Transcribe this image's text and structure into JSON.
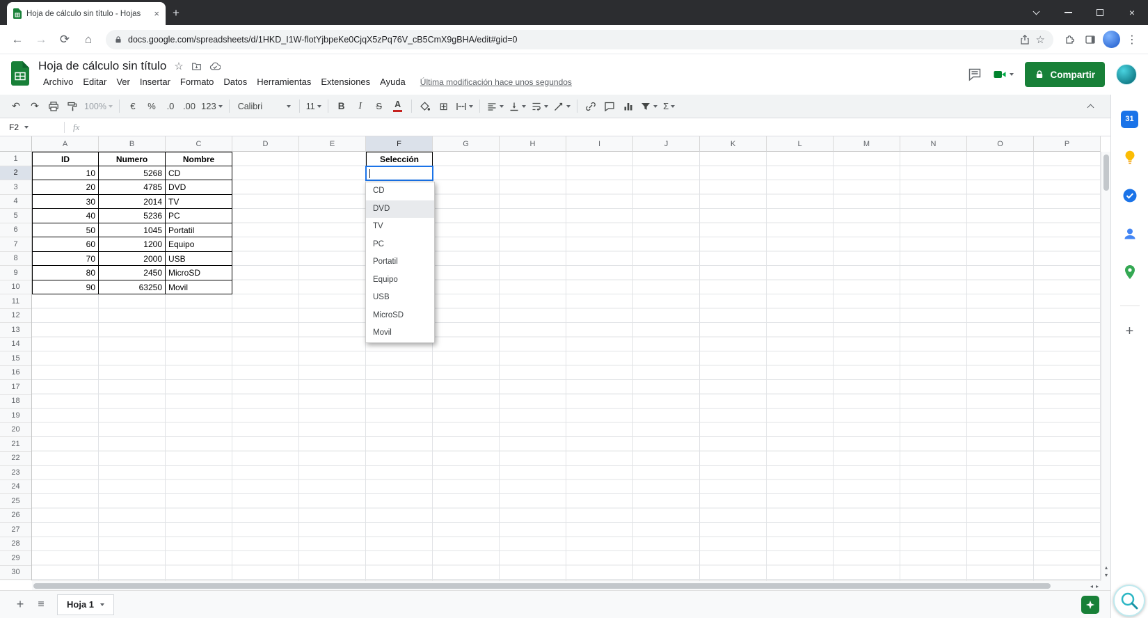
{
  "browser": {
    "tab_title": "Hoja de cálculo sin título - Hojas",
    "url": "docs.google.com/spreadsheets/d/1HKD_I1W-flotYjbpeKe0CjqX5zPq76V_cB5CmX9gBHA/edit#gid=0"
  },
  "icons": {
    "back": "←",
    "forward": "→",
    "reload": "⟳",
    "home": "⌂",
    "star": "☆",
    "kebab": "⋮",
    "new_tab": "+",
    "tab_close": "×",
    "close": "×",
    "undo": "↶",
    "redo": "↷",
    "borders": "⊞",
    "sigma": "Σ",
    "hamburger": "≡",
    "add_sheet": "+",
    "plus": "+",
    "scroll_left": "◂",
    "scroll_right": "▸",
    "scroll_up": "▴",
    "scroll_down": "▾"
  },
  "app": {
    "title": "Hoja de cálculo sin título",
    "menu_items": [
      "Archivo",
      "Editar",
      "Ver",
      "Insertar",
      "Formato",
      "Datos",
      "Herramientas",
      "Extensiones",
      "Ayuda"
    ],
    "last_modified": "Última modificación hace unos segundos",
    "share_button": "Compartir"
  },
  "toolbar": {
    "zoom": "100%",
    "currency": "€",
    "percent": "%",
    "dec_dec": ".0",
    "inc_dec": ".00",
    "num_fmt": "123",
    "font": "Calibri",
    "font_size": "11",
    "bold": "B",
    "italic": "I",
    "strike": "S",
    "text_color": "A"
  },
  "formula_bar": {
    "cell_ref": "F2",
    "fx": "fx"
  },
  "sheet": {
    "columns": [
      "A",
      "B",
      "C",
      "D",
      "E",
      "F",
      "G",
      "H",
      "I",
      "J",
      "K",
      "L",
      "M",
      "N",
      "O",
      "P"
    ],
    "rows": 30,
    "active_column": "F",
    "active_row": 2,
    "cells": [
      {
        "c": "A",
        "r": 1,
        "t": "ID",
        "bold": true,
        "align": "center",
        "box": true
      },
      {
        "c": "B",
        "r": 1,
        "t": "Numero",
        "bold": true,
        "align": "center",
        "box": true
      },
      {
        "c": "C",
        "r": 1,
        "t": "Nombre",
        "bold": true,
        "align": "center",
        "box": true
      },
      {
        "c": "F",
        "r": 1,
        "t": "Selección",
        "bold": true,
        "align": "center",
        "box": true
      },
      {
        "c": "A",
        "r": 2,
        "t": "10",
        "align": "right",
        "box": true
      },
      {
        "c": "B",
        "r": 2,
        "t": "5268",
        "align": "right",
        "box": true
      },
      {
        "c": "C",
        "r": 2,
        "t": "CD",
        "align": "left",
        "box": true
      },
      {
        "c": "A",
        "r": 3,
        "t": "20",
        "align": "right",
        "box": true
      },
      {
        "c": "B",
        "r": 3,
        "t": "4785",
        "align": "right",
        "box": true
      },
      {
        "c": "C",
        "r": 3,
        "t": "DVD",
        "align": "left",
        "box": true
      },
      {
        "c": "A",
        "r": 4,
        "t": "30",
        "align": "right",
        "box": true
      },
      {
        "c": "B",
        "r": 4,
        "t": "2014",
        "align": "right",
        "box": true
      },
      {
        "c": "C",
        "r": 4,
        "t": "TV",
        "align": "left",
        "box": true
      },
      {
        "c": "A",
        "r": 5,
        "t": "40",
        "align": "right",
        "box": true
      },
      {
        "c": "B",
        "r": 5,
        "t": "5236",
        "align": "right",
        "box": true
      },
      {
        "c": "C",
        "r": 5,
        "t": "PC",
        "align": "left",
        "box": true
      },
      {
        "c": "A",
        "r": 6,
        "t": "50",
        "align": "right",
        "box": true
      },
      {
        "c": "B",
        "r": 6,
        "t": "1045",
        "align": "right",
        "box": true
      },
      {
        "c": "C",
        "r": 6,
        "t": "Portatil",
        "align": "left",
        "box": true
      },
      {
        "c": "A",
        "r": 7,
        "t": "60",
        "align": "right",
        "box": true
      },
      {
        "c": "B",
        "r": 7,
        "t": "1200",
        "align": "right",
        "box": true
      },
      {
        "c": "C",
        "r": 7,
        "t": "Equipo",
        "align": "left",
        "box": true
      },
      {
        "c": "A",
        "r": 8,
        "t": "70",
        "align": "right",
        "box": true
      },
      {
        "c": "B",
        "r": 8,
        "t": "2000",
        "align": "right",
        "box": true
      },
      {
        "c": "C",
        "r": 8,
        "t": "USB",
        "align": "left",
        "box": true
      },
      {
        "c": "A",
        "r": 9,
        "t": "80",
        "align": "right",
        "box": true
      },
      {
        "c": "B",
        "r": 9,
        "t": "2450",
        "align": "right",
        "box": true
      },
      {
        "c": "C",
        "r": 9,
        "t": "MicroSD",
        "align": "left",
        "box": true
      },
      {
        "c": "A",
        "r": 10,
        "t": "90",
        "align": "right",
        "box": true
      },
      {
        "c": "B",
        "r": 10,
        "t": "63250",
        "align": "right",
        "box": true
      },
      {
        "c": "C",
        "r": 10,
        "t": "Movil",
        "align": "left",
        "box": true
      }
    ]
  },
  "dropdown": {
    "items": [
      "CD",
      "DVD",
      "TV",
      "PC",
      "Portatil",
      "Equipo",
      "USB",
      "MicroSD",
      "Movil"
    ],
    "highlighted_index": 1
  },
  "sheet_tabs": {
    "name": "Hoja 1"
  },
  "side_panel": {
    "calendar_label": "31"
  },
  "colors": {
    "accent": "#1a73e8",
    "share_green": "#188038",
    "sheets_green": "#188038",
    "table_border": "#000000"
  }
}
